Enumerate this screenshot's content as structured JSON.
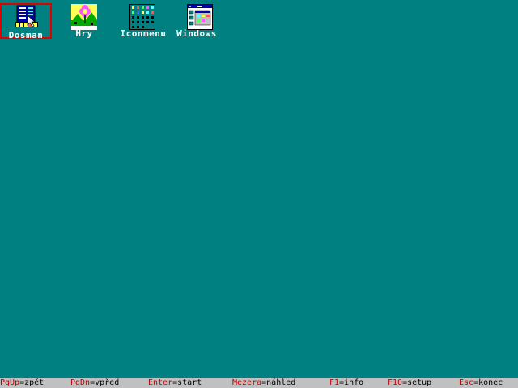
{
  "desktop": {
    "background": "#008080",
    "icons": [
      {
        "label": "Dosman",
        "icon": "dosman-file-manager-icon",
        "selected": true
      },
      {
        "label": "Hry",
        "icon": "games-flower-icon",
        "selected": false
      },
      {
        "label": "Iconmenu",
        "icon": "iconmenu-grid-icon",
        "selected": false
      },
      {
        "label": "Windows",
        "icon": "windows-program-manager-icon",
        "selected": false
      }
    ]
  },
  "statusbar": {
    "background": "#c0c0c0",
    "key_color": "#c00000",
    "hints": [
      {
        "key": "PgUp",
        "sep": "=",
        "action": "zpět"
      },
      {
        "key": "PgDn",
        "sep": "=",
        "action": "vpřed"
      },
      {
        "key": "Enter",
        "sep": "=",
        "action": "start"
      },
      {
        "key": "Mezera",
        "sep": "=",
        "action": "náhled"
      },
      {
        "key": "F1",
        "sep": "=",
        "action": "info"
      },
      {
        "key": "F10",
        "sep": "=",
        "action": "setup"
      },
      {
        "key": "Esc",
        "sep": "=",
        "action": "konec"
      }
    ]
  }
}
